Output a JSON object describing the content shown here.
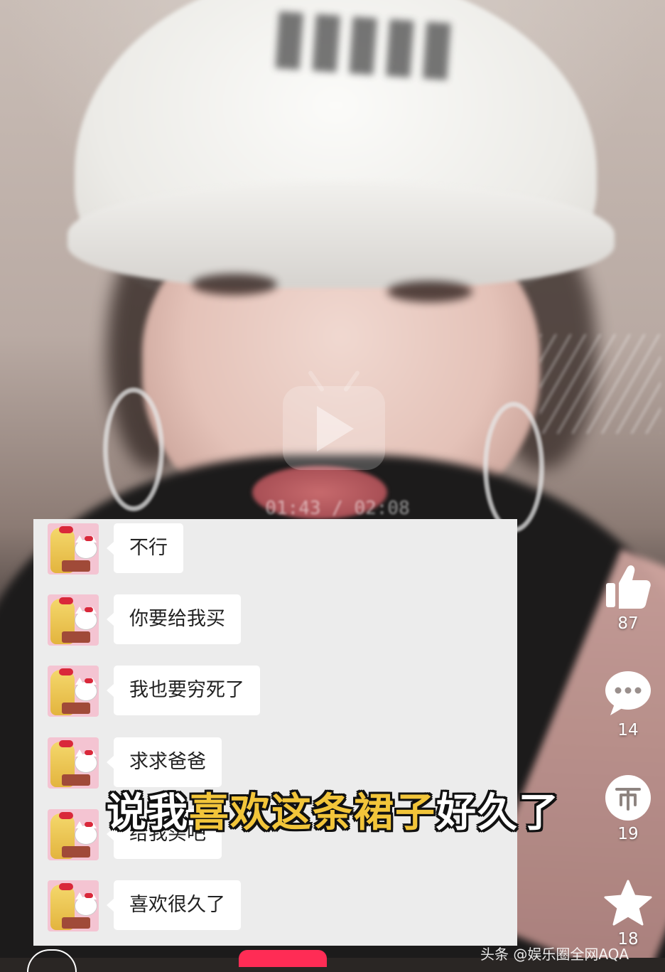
{
  "chat": {
    "messages": [
      {
        "text": "不行"
      },
      {
        "text": "你要给我买"
      },
      {
        "text": "我也要穷死了"
      },
      {
        "text": "求求爸爸"
      },
      {
        "text": "给我买吧"
      },
      {
        "text": "喜欢很久了"
      }
    ]
  },
  "subtitle": {
    "part1": "说我",
    "part2": "喜欢这条裙子",
    "part3": "好久了",
    "colors": {
      "white": "#ffffff",
      "yellow": "#f2c53a"
    }
  },
  "video": {
    "timestamp": "01:43 / 02:08",
    "center_icon": "play-icon"
  },
  "actions": {
    "like": {
      "icon": "thumbs-up-icon",
      "count": "87"
    },
    "comment": {
      "icon": "comment-icon",
      "count": "14"
    },
    "coin": {
      "icon": "coin-icon",
      "count": "19"
    },
    "favorite": {
      "icon": "star-icon",
      "count": "18"
    }
  },
  "footer": {
    "watermark": "头条 @娱乐圈全网AQA"
  }
}
